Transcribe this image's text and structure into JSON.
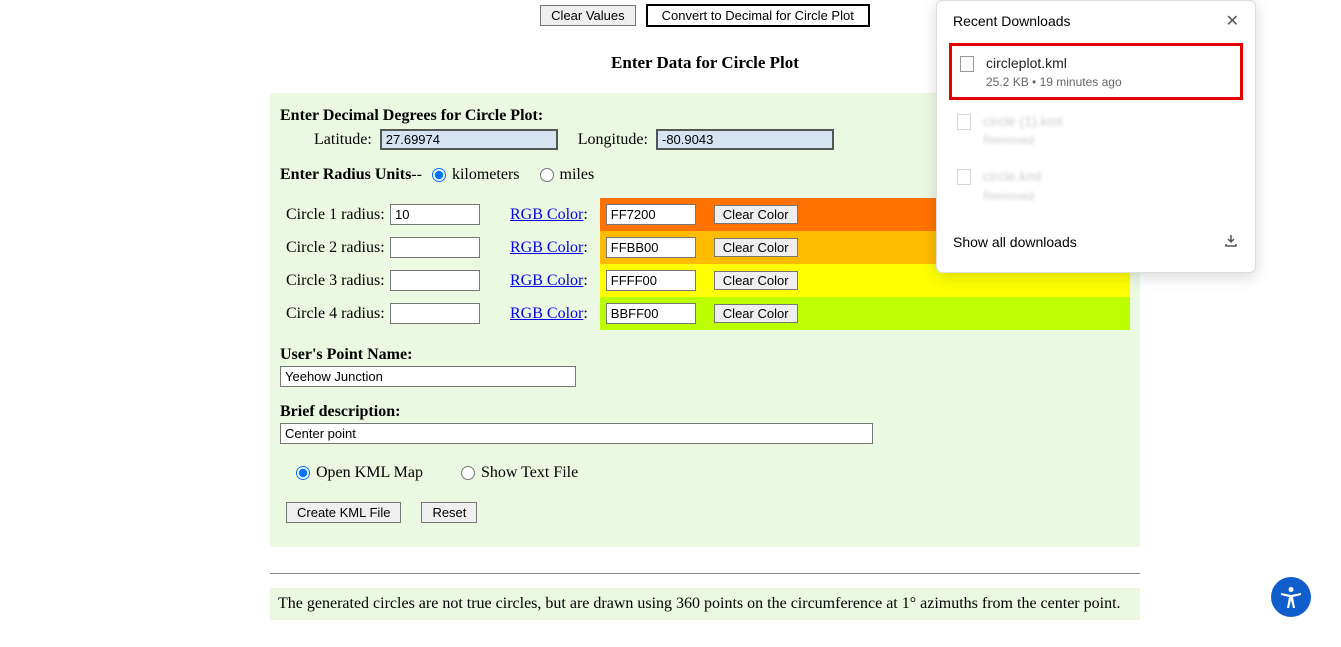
{
  "topButtons": {
    "clear": "Clear Values",
    "convert": "Convert to Decimal for Circle Plot"
  },
  "title": "Enter Data for Circle Plot",
  "coords": {
    "heading": "Enter Decimal Degrees for Circle Plot:",
    "latLabel": "Latitude:",
    "latValue": "27.69974",
    "lonLabel": "Longitude:",
    "lonValue": "-80.9043"
  },
  "radiusUnits": {
    "label": "Enter Radius Units",
    "sep": " -- ",
    "km": "kilometers",
    "mi": "miles",
    "selected": "km"
  },
  "circles": [
    {
      "label": "Circle 1 radius:",
      "radius": "10",
      "rgbLabel": "RGB Color",
      "color": "FF7200",
      "bg": "#FF7200",
      "clear": "Clear Color"
    },
    {
      "label": "Circle 2 radius:",
      "radius": "",
      "rgbLabel": "RGB Color",
      "color": "FFBB00",
      "bg": "#FFBB00",
      "clear": "Clear Color"
    },
    {
      "label": "Circle 3 radius:",
      "radius": "",
      "rgbLabel": "RGB Color",
      "color": "FFFF00",
      "bg": "#FFFF00",
      "clear": "Clear Color"
    },
    {
      "label": "Circle 4 radius:",
      "radius": "",
      "rgbLabel": "RGB Color",
      "color": "BBFF00",
      "bg": "#BBFF00",
      "clear": "Clear Color"
    }
  ],
  "pointName": {
    "label": "User's Point Name:",
    "value": "Yeehow Junction"
  },
  "description": {
    "label": "Brief description:",
    "value": "Center point"
  },
  "output": {
    "openKml": "Open KML Map",
    "showText": "Show Text File",
    "selected": "openKml"
  },
  "bottomButtons": {
    "create": "Create KML File",
    "reset": "Reset"
  },
  "note": "The generated circles are not true circles, but are drawn using 360 points on the circumference at 1° azimuths from the center point.",
  "downloads": {
    "title": "Recent Downloads",
    "items": [
      {
        "name": "circleplot.kml",
        "meta": "25.2 KB • 19 minutes ago",
        "highlighted": true
      },
      {
        "name": "circle (1).kml",
        "meta": "Removed",
        "faded": true
      },
      {
        "name": "circle.kml",
        "meta": "Removed",
        "faded": true
      }
    ],
    "showAll": "Show all downloads"
  }
}
